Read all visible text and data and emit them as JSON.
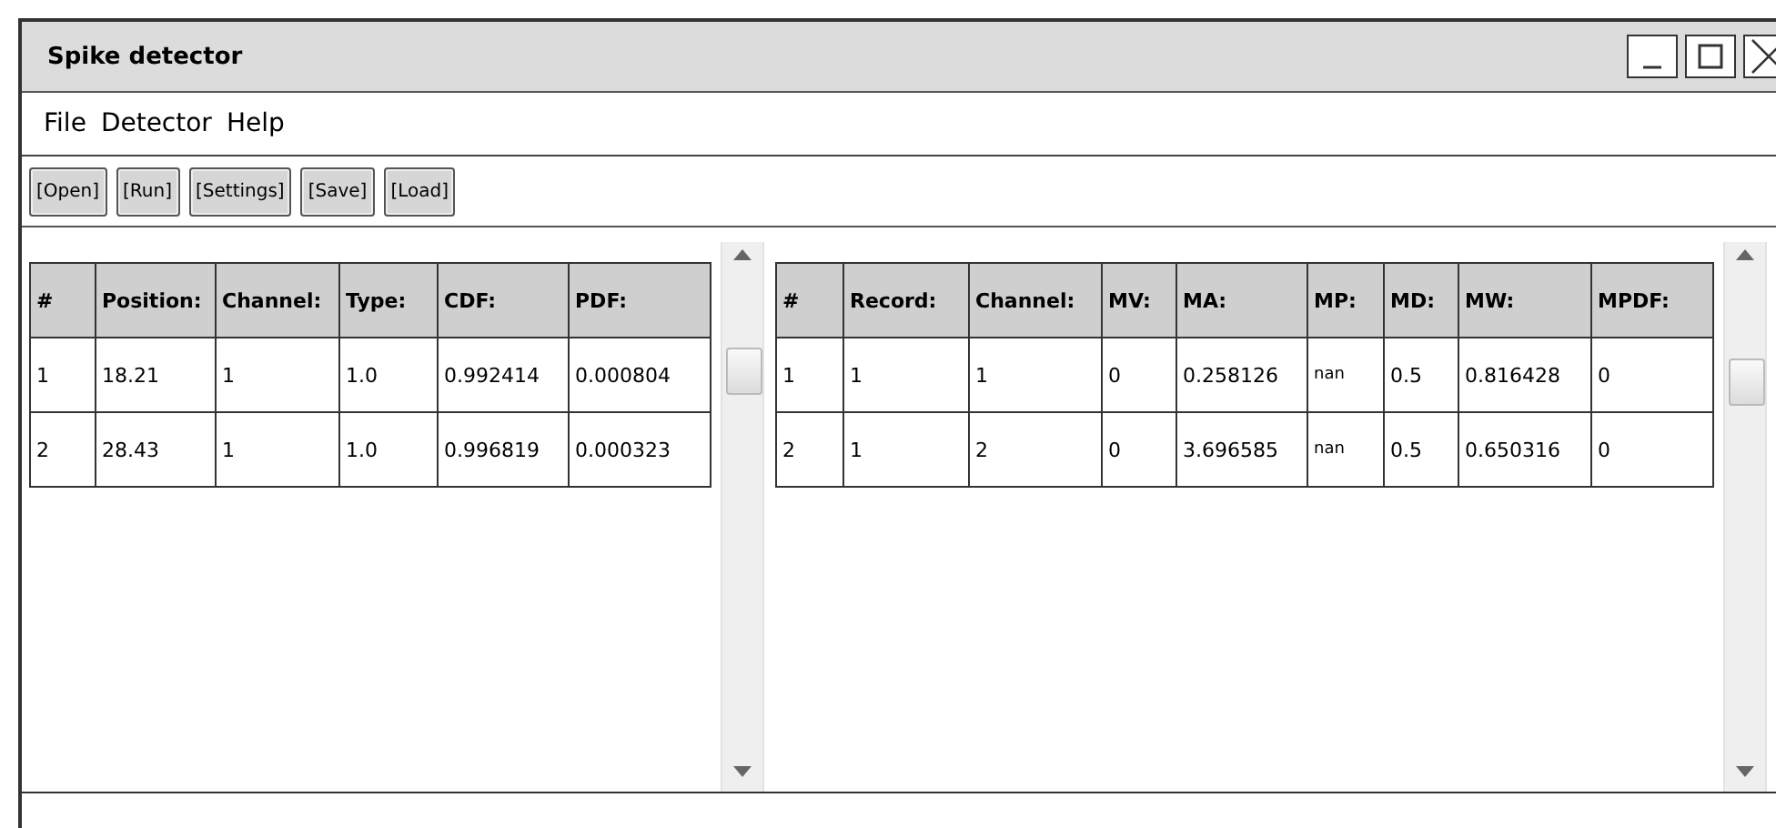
{
  "window": {
    "title": "Spike detector"
  },
  "menu": [
    "File",
    "Detector",
    "Help"
  ],
  "toolbar": [
    "[Open]",
    "[Run]",
    "[Settings]",
    "[Save]",
    "[Load]"
  ],
  "spikes_table": {
    "columns": [
      "#",
      "Position:",
      "Channel:",
      "Type:",
      "CDF:",
      "PDF:"
    ],
    "rows": [
      [
        "1",
        "18.21",
        "1",
        "1.0",
        "0.992414",
        "0.000804"
      ],
      [
        "2",
        "28.43",
        "1",
        "1.0",
        "0.996819",
        "0.000323"
      ]
    ]
  },
  "records_table": {
    "columns": [
      "#",
      "Record:",
      "Channel:",
      "MV:",
      "MA:",
      "MP:",
      "MD:",
      "MW:",
      "MPDF:"
    ],
    "rows": [
      [
        "1",
        "1",
        "1",
        "0",
        "0.258126",
        "nan",
        "0.5",
        "0.816428",
        "0"
      ],
      [
        "2",
        "1",
        "2",
        "0",
        "3.696585",
        "nan",
        "0.5",
        "0.650316",
        "0"
      ]
    ]
  }
}
